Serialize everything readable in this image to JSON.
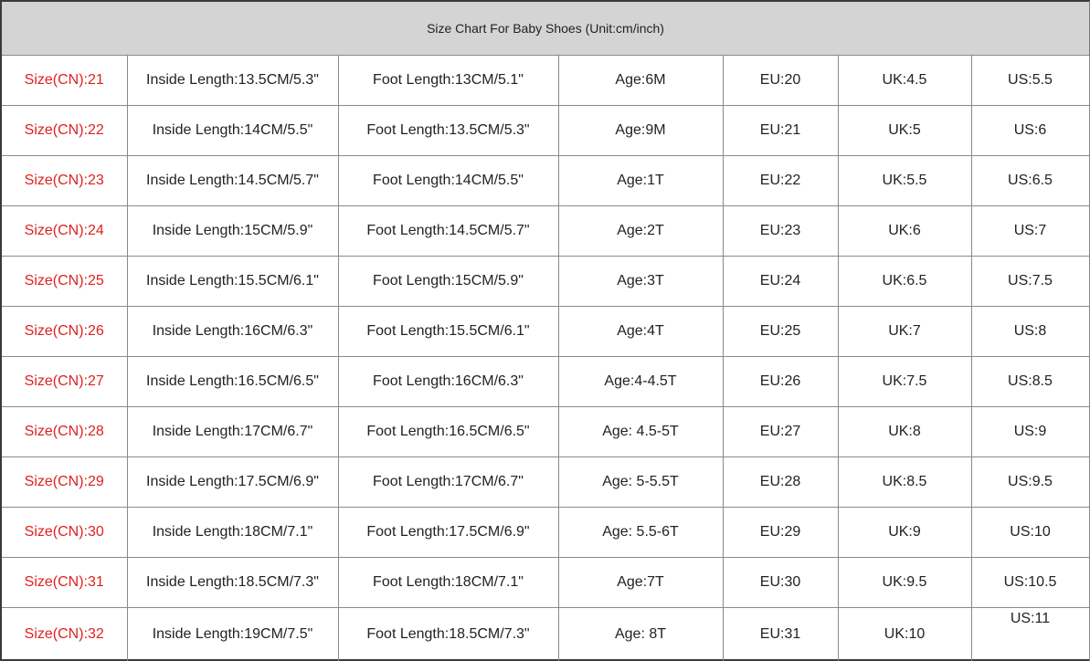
{
  "title": "Size Chart For Baby Shoes (Unit:cm/inch)",
  "colors": {
    "size_text": "#e02020",
    "header_bg": "#d4d4d4",
    "grid": "#8a8a8a",
    "text": "#222222"
  },
  "rows": [
    {
      "size": "Size(CN):21",
      "inside": "Inside Length:13.5CM/5.3\"",
      "foot": "Foot Length:13CM/5.1\"",
      "age": "Age:6M",
      "eu": "EU:20",
      "uk": "UK:4.5",
      "us": "US:5.5"
    },
    {
      "size": "Size(CN):22",
      "inside": "Inside Length:14CM/5.5\"",
      "foot": "Foot Length:13.5CM/5.3\"",
      "age": "Age:9M",
      "eu": "EU:21",
      "uk": "UK:5",
      "us": "US:6"
    },
    {
      "size": "Size(CN):23",
      "inside": "Inside Length:14.5CM/5.7\"",
      "foot": "Foot Length:14CM/5.5\"",
      "age": "Age:1T",
      "eu": "EU:22",
      "uk": "UK:5.5",
      "us": "US:6.5"
    },
    {
      "size": "Size(CN):24",
      "inside": "Inside Length:15CM/5.9\"",
      "foot": "Foot Length:14.5CM/5.7\"",
      "age": "Age:2T",
      "eu": "EU:23",
      "uk": "UK:6",
      "us": "US:7"
    },
    {
      "size": "Size(CN):25",
      "inside": "Inside Length:15.5CM/6.1\"",
      "foot": "Foot Length:15CM/5.9\"",
      "age": "Age:3T",
      "eu": "EU:24",
      "uk": "UK:6.5",
      "us": "US:7.5"
    },
    {
      "size": "Size(CN):26",
      "inside": "Inside Length:16CM/6.3\"",
      "foot": "Foot Length:15.5CM/6.1\"",
      "age": "Age:4T",
      "eu": "EU:25",
      "uk": "UK:7",
      "us": "US:8"
    },
    {
      "size": "Size(CN):27",
      "inside": "Inside Length:16.5CM/6.5\"",
      "foot": "Foot Length:16CM/6.3\"",
      "age": "Age:4-4.5T",
      "eu": "EU:26",
      "uk": "UK:7.5",
      "us": "US:8.5"
    },
    {
      "size": "Size(CN):28",
      "inside": "Inside Length:17CM/6.7\"",
      "foot": "Foot Length:16.5CM/6.5\"",
      "age": "Age: 4.5-5T",
      "eu": "EU:27",
      "uk": "UK:8",
      "us": "US:9"
    },
    {
      "size": "Size(CN):29",
      "inside": "Inside Length:17.5CM/6.9\"",
      "foot": "Foot Length:17CM/6.7\"",
      "age": "Age: 5-5.5T",
      "eu": "EU:28",
      "uk": "UK:8.5",
      "us": "US:9.5"
    },
    {
      "size": "Size(CN):30",
      "inside": "Inside Length:18CM/7.1\"",
      "foot": "Foot Length:17.5CM/6.9\"",
      "age": "Age: 5.5-6T",
      "eu": "EU:29",
      "uk": "UK:9",
      "us": "US:10"
    },
    {
      "size": "Size(CN):31",
      "inside": "Inside Length:18.5CM/7.3\"",
      "foot": "Foot Length:18CM/7.1\"",
      "age": "Age:7T",
      "eu": "EU:30",
      "uk": "UK:9.5",
      "us": "US:10.5"
    },
    {
      "size": "Size(CN):32",
      "inside": "Inside Length:19CM/7.5\"",
      "foot": "Foot Length:18.5CM/7.3\"",
      "age": "Age: 8T",
      "eu": "EU:31",
      "uk": "UK:10",
      "us": "US:11"
    }
  ]
}
